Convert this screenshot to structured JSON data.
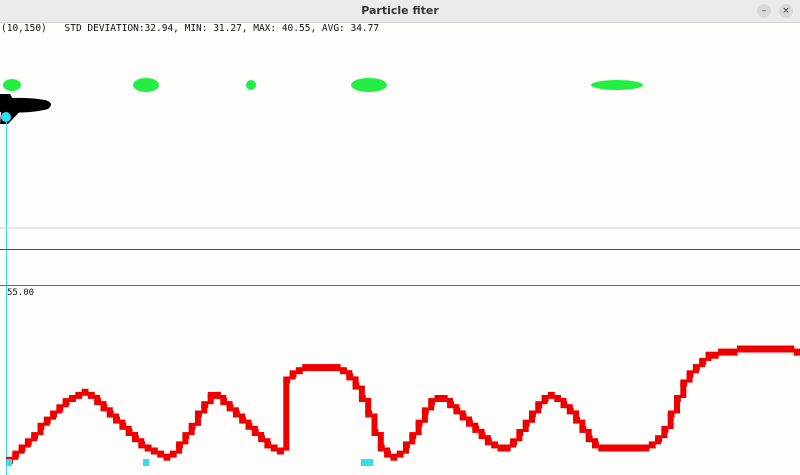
{
  "window": {
    "title": "Particle fiter",
    "minimize_glyph": "–",
    "maximize_glyph": "□",
    "close_glyph": "×"
  },
  "readout": {
    "coord": "(10,150)",
    "stats": "STD DEVIATION:32.94, MIN: 31.27, MAX: 40.55, AVG: 34.77"
  },
  "lower_panel": {
    "y_max_label": "55.00"
  },
  "colors": {
    "particles": "#22ee44",
    "plane": "#000000",
    "cursor_line": "#33ddee",
    "blue_line": "#3344cc",
    "red_line": "#ee3333",
    "terrain": "#ee0000",
    "highlight": "#33ddee"
  },
  "icons": {
    "plane": "airplane-icon",
    "close": "close-icon",
    "minimize": "minimize-icon",
    "maximize": "maximize-icon"
  },
  "terrain_profile": {
    "y_max": 55.0,
    "y_min": 0,
    "step_width_units": 1,
    "values": [
      2,
      4,
      6,
      8,
      10,
      13,
      15,
      17,
      19,
      21,
      22,
      23,
      24,
      23,
      21,
      19,
      17,
      15,
      13,
      11,
      9,
      7,
      6,
      5,
      4,
      3,
      4,
      7,
      10,
      13,
      17,
      20,
      23,
      23,
      21,
      19,
      17,
      15,
      13,
      11,
      9,
      7,
      6,
      5,
      28,
      30,
      31,
      32,
      32,
      32,
      32,
      32,
      32,
      31,
      29,
      26,
      22,
      17,
      11,
      6,
      4,
      3,
      4,
      7,
      10,
      14,
      18,
      21,
      22,
      22,
      20,
      18,
      16,
      14,
      12,
      10,
      8,
      7,
      6,
      6,
      8,
      11,
      14,
      17,
      20,
      22,
      23,
      22,
      20,
      18,
      15,
      12,
      9,
      7,
      6,
      6,
      6,
      6,
      6,
      6,
      6,
      6,
      7,
      9,
      12,
      17,
      22,
      27,
      30,
      32,
      34,
      36,
      36,
      37,
      37,
      37,
      38,
      38,
      38,
      38,
      38,
      38,
      38,
      38,
      38,
      37
    ]
  }
}
